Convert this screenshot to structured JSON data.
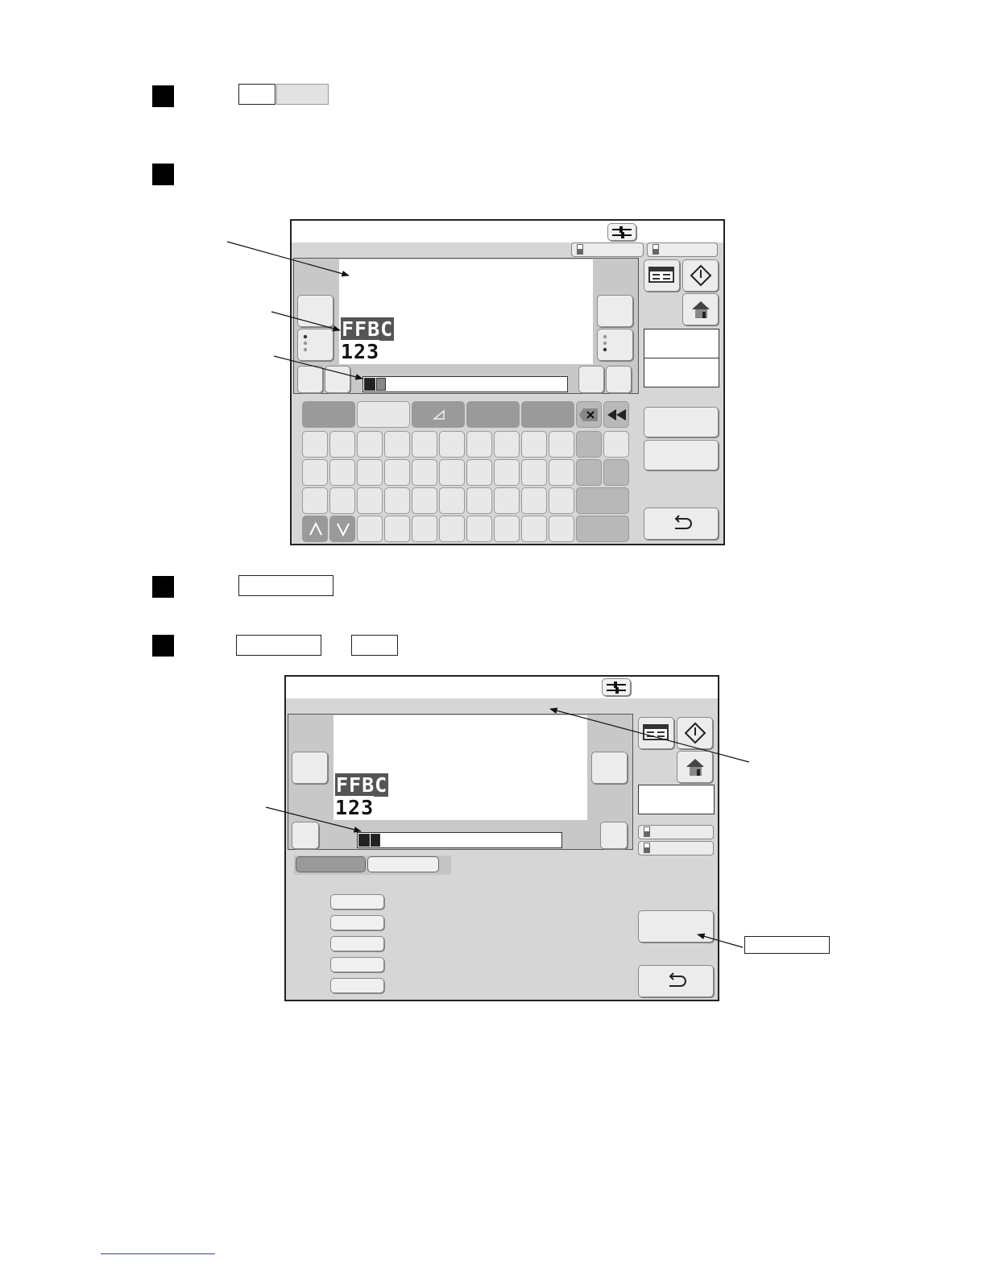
{
  "steps": [
    {
      "marker": "step-1"
    },
    {
      "marker": "step-2"
    },
    {
      "marker": "step-3"
    },
    {
      "marker": "step-4"
    }
  ],
  "screen1": {
    "preview_line1": "FFBC",
    "preview_line2": "123",
    "icons": [
      "settings-icon",
      "print-icon",
      "start-icon",
      "home-icon",
      "return-icon",
      "delete-icon",
      "backspace-icon",
      "up-arrow-icon",
      "down-arrow-icon"
    ]
  },
  "screen2": {
    "preview_line1": "FFBC",
    "preview_line2": "123",
    "icons": [
      "settings-icon",
      "print-icon",
      "start-icon",
      "home-icon",
      "return-icon"
    ]
  },
  "colors": {
    "frame_bg": "#d6d6d6",
    "button": "#ececec",
    "dark_key": "#8f8f8f",
    "footer_link": "#2346c8"
  }
}
